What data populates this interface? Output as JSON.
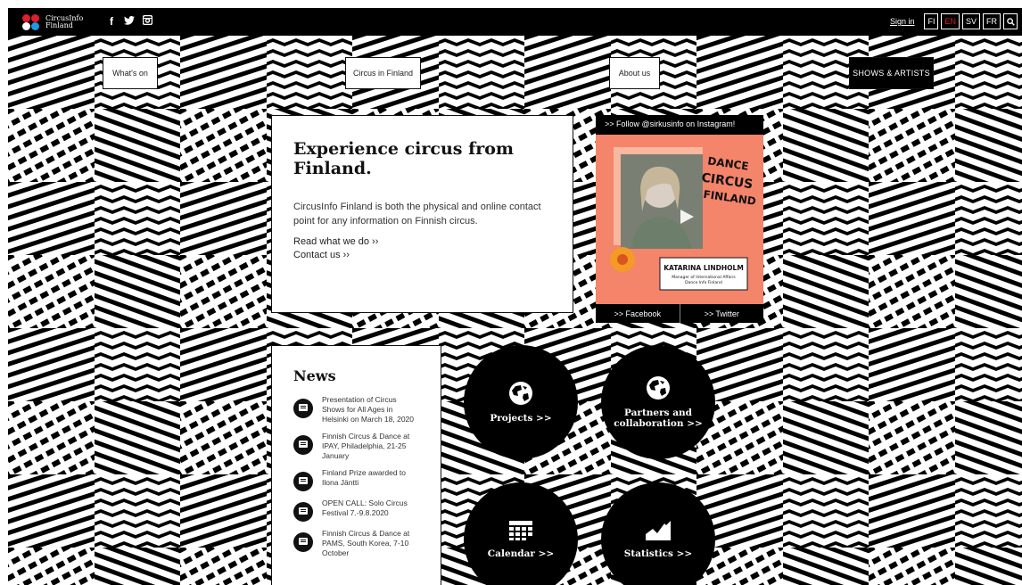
{
  "header": {
    "logo_line1": "CircusInfo",
    "logo_line2": "Finland",
    "logo_dot_colors": [
      "#e11d2e",
      "#e11d2e",
      "#ffffff",
      "#1e9be0"
    ],
    "social_icons": [
      "facebook-icon",
      "twitter-icon",
      "instagram-icon"
    ],
    "signin": "Sign in",
    "languages": [
      "FI",
      "EN",
      "SV",
      "FR"
    ],
    "active_language": "EN"
  },
  "nav": {
    "whats_on": "What's on",
    "circus_in_finland": "Circus in Finland",
    "about_us": "About us",
    "shows_artists": "SHOWS & ARTISTS"
  },
  "hero": {
    "title": "Experience circus from Finland.",
    "body": "CircusInfo Finland is both the physical and online contact point for any information on Finnish circus.",
    "link_read": "Read what we do ››",
    "link_contact": "Contact us ››"
  },
  "instagram": {
    "header": ">> Follow @sirkusinfo on Instagram!",
    "image_text": "DANCE & CIRCUS FINLAND",
    "caption_name": "KATARINA LINDHOLM",
    "caption_role_line1": "Manager of International Affairs",
    "caption_role_line2": "Dance Info Finland",
    "facebook": ">> Facebook",
    "twitter": ">> Twitter"
  },
  "news": {
    "title": "News",
    "items": [
      "Presentation of Circus Shows for All Ages in Helsinki on March 18, 2020",
      "Finnish Circus & Dance at IPAY, Philadelphia, 21-25 January",
      "Finland Prize awarded to Ilona Jäntti",
      "OPEN CALL: Solo Circus Festival 7.-9.8.2020",
      "Finnish Circus & Dance at PAMS, South Korea, 7-10 October"
    ]
  },
  "tiles": {
    "projects": "Projects >>",
    "partners": "Partners and collaboration >>",
    "calendar": "Calendar >>",
    "statistics": "Statistics >>"
  },
  "colors": {
    "brand_red": "#e11d2e",
    "brand_blue": "#1e9be0",
    "instagram_bg": "#f4846a"
  }
}
